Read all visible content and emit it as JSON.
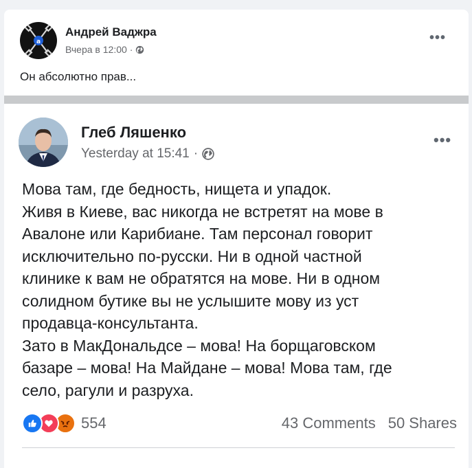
{
  "outer_post": {
    "author": "Андрей Ваджра",
    "timestamp": "Вчера в 12:00",
    "separator": "·",
    "privacy_icon": "globe-icon",
    "menu_label": "•••",
    "caption": "Он абсолютно прав..."
  },
  "shared_post": {
    "author": "Глеб Ляшенко",
    "timestamp": "Yesterday at 15:41",
    "separator": "·",
    "privacy_icon": "globe-icon",
    "menu_label": "•••",
    "lines": [
      "Мова там, где бедность, нищета и упадок.",
      "Живя в Киеве, вас никогда не встретят на мове в",
      "Авалоне или Карибиане. Там персонал говорит",
      "исключительно по-русски. Ни в одной частной",
      "клинике к вам не обратятся на мове. Ни в одном",
      "солидном бутике вы не услышите мову из уст",
      "продавца-консультанта.",
      "Зато в МакДональдсе – мова! На борщаговском",
      "базаре – мова! На Майдане – мова! Мова там, где",
      "село, рагули и разруха."
    ],
    "reactions": {
      "icons": [
        "like-icon",
        "love-icon",
        "angry-icon"
      ],
      "count": "554"
    },
    "comments": "43 Comments",
    "shares": "50 Shares"
  },
  "colors": {
    "facebook_blue": "#1877f2",
    "love_red": "#f33e58",
    "angry_orange": "#e9710f",
    "meta_gray": "#65676b"
  }
}
